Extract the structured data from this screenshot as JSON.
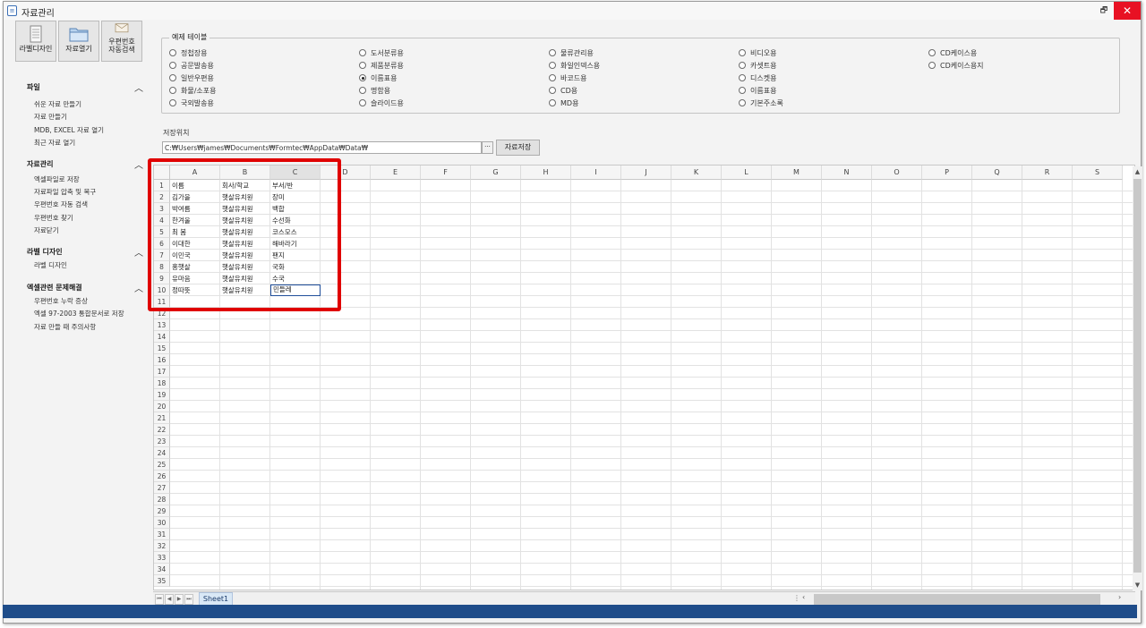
{
  "window": {
    "title": "자료관리",
    "icon": "document-icon",
    "restore_glyph": "🗗",
    "close_glyph": "✕"
  },
  "toolbar": {
    "label_design": "라벨디자인",
    "open_data": "자료열기",
    "postal_search_line1": "우편번호",
    "postal_search_line2": "자동검색"
  },
  "sidebar": {
    "sections": [
      {
        "title": "파일",
        "items": [
          "쉬운 자료 만들기",
          "자료 만들기",
          "MDB, EXCEL 자료 열기",
          "최근 자료 열기"
        ]
      },
      {
        "title": "자료관리",
        "items": [
          "엑셀파일로 저장",
          "자료파일 압축 및 복구",
          "우편번호 자동 검색",
          "우편번호 찾기",
          "자료닫기"
        ]
      },
      {
        "title": "라벨 디자인",
        "items": [
          "라벨 디자인"
        ]
      },
      {
        "title": "엑셀관련 문제해결",
        "items": [
          "우편번호 누락 증상",
          "엑셀 97-2003 통합문서로 저장",
          "자료 만들 때 주의사항"
        ]
      }
    ],
    "chevron": "︿"
  },
  "examples": {
    "title": "예제 테이블",
    "columns": [
      [
        "정첩장용",
        "공문발송용",
        "일반우편용",
        "화물/소포용",
        "국외발송용"
      ],
      [
        "도서분류용",
        "제품분류용",
        "이름표용",
        "명함용",
        "슬라이드용"
      ],
      [
        "물류관리용",
        "화일인덱스용",
        "바코드용",
        "CD용",
        "MD용"
      ],
      [
        "비디오용",
        "카셋트용",
        "디스켓용",
        "이름표용",
        "기본주소록"
      ],
      [
        "CD케이스용",
        "CD케이스용지"
      ]
    ],
    "selected": "이름표용"
  },
  "save": {
    "label": "저장위치",
    "path": "C:₩Users₩james₩Documents₩Formtec₩AppData₩Data₩",
    "ellipsis": "···",
    "button": "자료저장"
  },
  "sheet": {
    "columns": [
      "A",
      "B",
      "C",
      "D",
      "E",
      "F",
      "G",
      "H",
      "I",
      "J",
      "K",
      "L",
      "M",
      "N",
      "O",
      "P",
      "Q",
      "R",
      "S"
    ],
    "row_count": 35,
    "rows": [
      [
        "이름",
        "회사/학교",
        "부서/반"
      ],
      [
        "김가을",
        "햇살유치원",
        "장미"
      ],
      [
        "박여름",
        "햇살유치원",
        "백합"
      ],
      [
        "한겨울",
        "햇살유치원",
        "수선화"
      ],
      [
        "최 봄",
        "햇살유치원",
        "코스모스"
      ],
      [
        "이대한",
        "햇살유치원",
        "해바라기"
      ],
      [
        "이민국",
        "햇살유치원",
        "팬지"
      ],
      [
        "홍햇살",
        "햇살유치원",
        "국화"
      ],
      [
        "유마음",
        "햇살유치원",
        "수국"
      ],
      [
        "정따뜻",
        "햇살유치원",
        "민들레"
      ]
    ],
    "active_cell": "C10",
    "tab_name": "Sheet1",
    "nav": [
      "⏮",
      "◀",
      "▶",
      "⏭"
    ]
  },
  "colors": {
    "highlight": "#e00000",
    "statusbar": "#1f4d8a",
    "close": "#e81123"
  }
}
